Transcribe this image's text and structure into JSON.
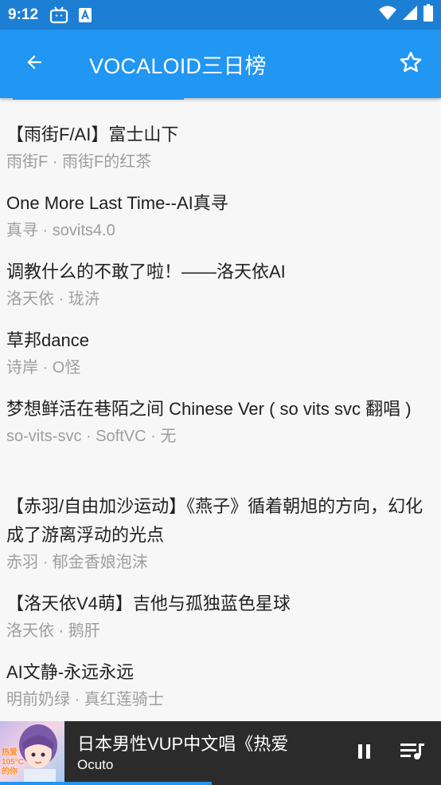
{
  "status": {
    "time": "9:12"
  },
  "app_bar": {
    "title": "VOCALOID三日榜"
  },
  "songs": [
    {
      "title": "【雨街F/AI】富士山下",
      "subtitle": "雨街F · 雨街F的红茶"
    },
    {
      "title": "One More Last Time--AI真寻",
      "subtitle": "真寻 · sovits4.0"
    },
    {
      "title": "调教什么的不敢了啦！——洛天依AI",
      "subtitle": "洛天依 · 珑泋"
    },
    {
      "title": "草邦dance",
      "subtitle": "诗岸 · O怪"
    },
    {
      "title": "梦想鲜活在巷陌之间 Chinese Ver ( so vits svc 翻唱 )",
      "subtitle": "so-vits-svc · SoftVC · 无"
    },
    {
      "title": "【赤羽/自由加沙运动】《燕子》循着朝旭的方向，幻化成了游离浮动的光点",
      "subtitle": "赤羽 · 郁金香娘泡沫"
    },
    {
      "title": "【洛天依V4萌】吉他与孤独蓝色星球",
      "subtitle": "洛天依 · 鹅肝"
    },
    {
      "title": "AI文静-永远永远",
      "subtitle": "明前奶绿 · 真红莲骑士"
    }
  ],
  "player": {
    "song": "日本男性VUP中文唱《热爱",
    "artist": "Ocuto",
    "cover_text": "热爱105°C的你",
    "progress": 0.48
  },
  "colors": {
    "status_bar": "#1d7fd4",
    "app_bar": "#2196f3",
    "accent": "#2196f3",
    "player_bg": "#2b2b2b"
  }
}
